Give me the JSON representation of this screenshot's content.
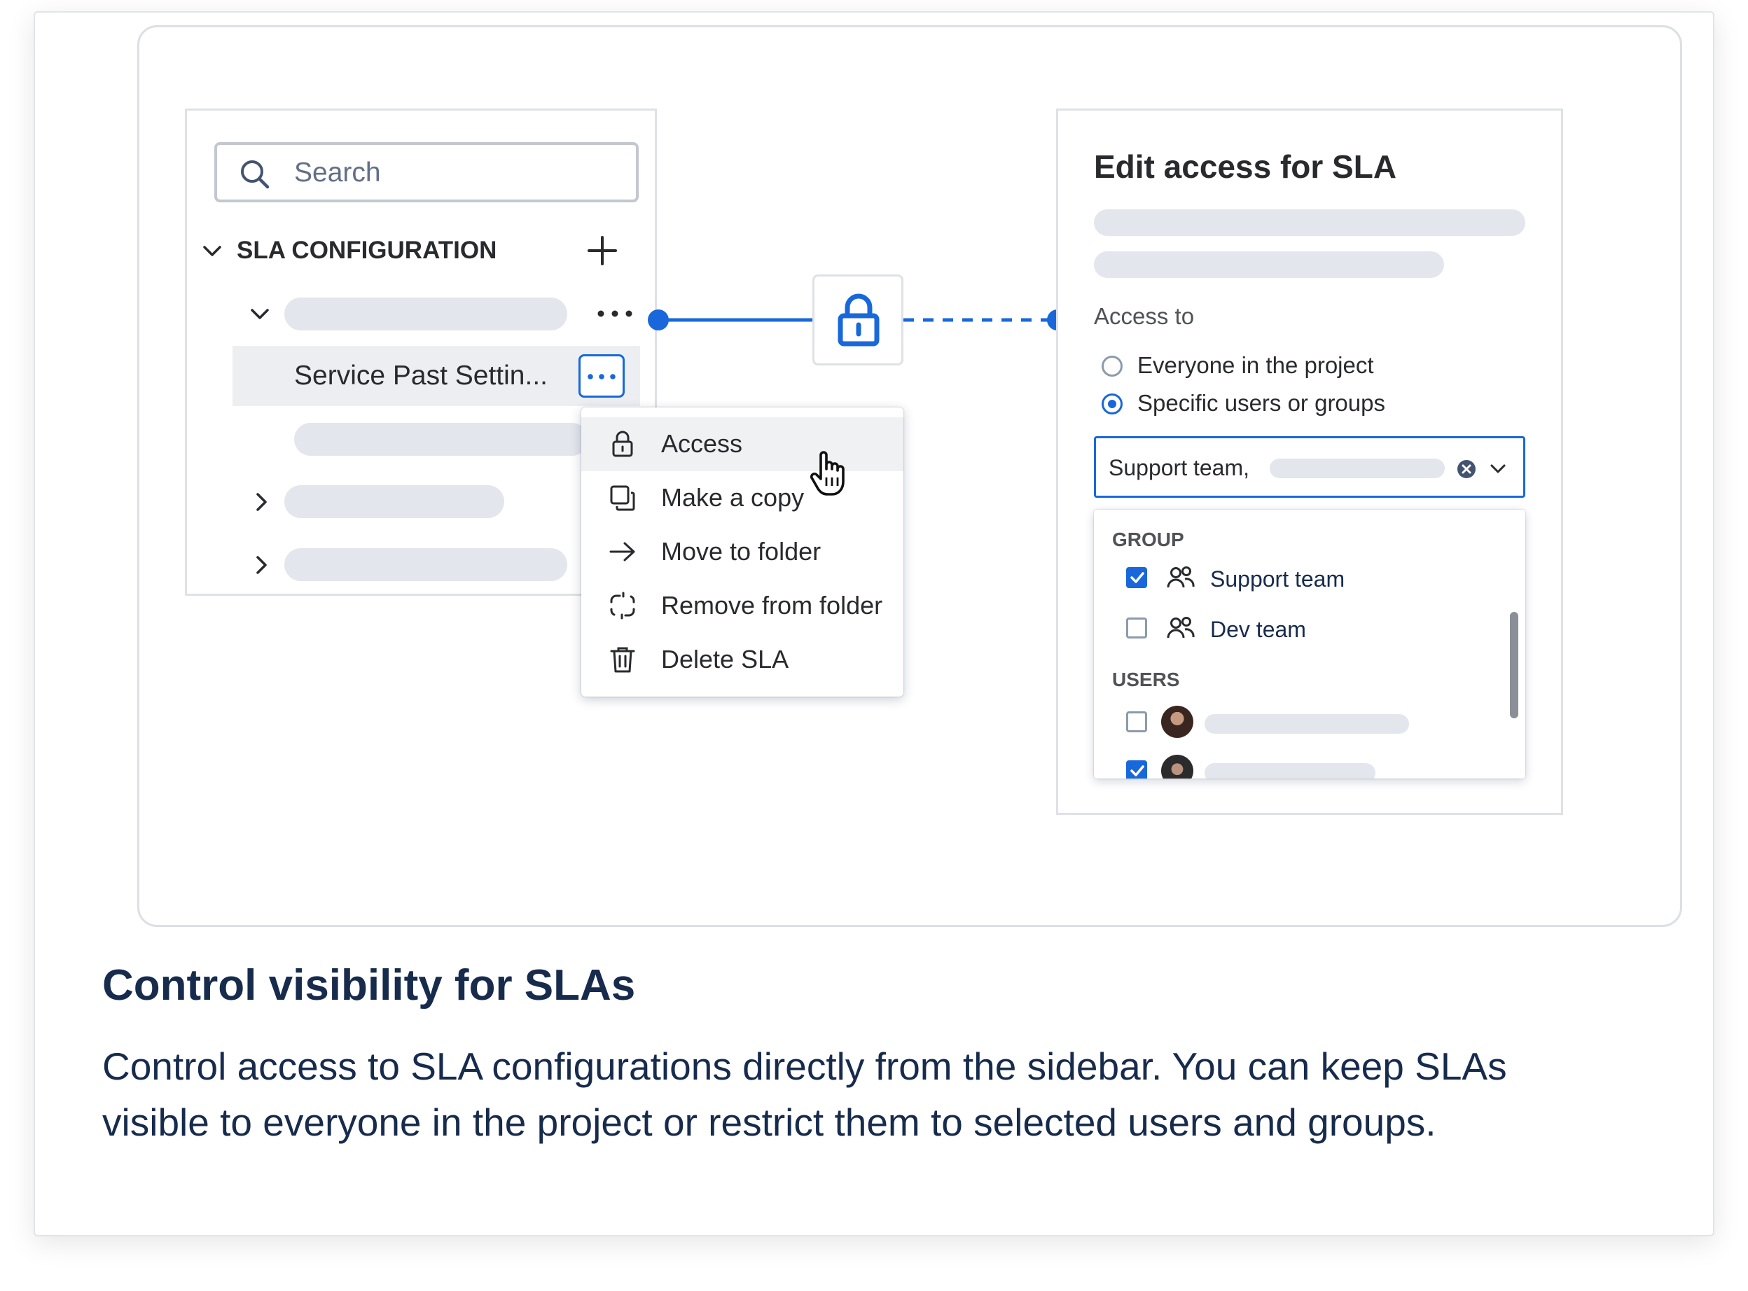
{
  "sidebar": {
    "search": {
      "placeholder": "Search",
      "icon": "search-icon"
    },
    "section_title": "SLA CONFIGURATION",
    "selected_item": "Service Past Settin...",
    "context_menu": {
      "items": [
        {
          "label": "Access",
          "icon": "lock-icon"
        },
        {
          "label": "Make a copy",
          "icon": "copy-icon"
        },
        {
          "label": "Move to folder",
          "icon": "arrow-right-icon"
        },
        {
          "label": "Remove from folder",
          "icon": "unlink-icon"
        },
        {
          "label": "Delete SLA",
          "icon": "trash-icon"
        }
      ]
    }
  },
  "connector": {
    "icon": "lock-icon",
    "color": "#1868db"
  },
  "access_panel": {
    "title": "Edit access for SLA",
    "access_label": "Access to",
    "options": [
      {
        "label": "Everyone in the project",
        "selected": false
      },
      {
        "label": "Specific users or groups",
        "selected": true
      }
    ],
    "select": {
      "value": "Support team,"
    },
    "dropdown": {
      "group_header": "GROUP",
      "groups": [
        {
          "label": "Support team",
          "checked": true
        },
        {
          "label": "Dev team",
          "checked": false
        }
      ],
      "users_header": "USERS",
      "users": [
        {
          "checked": false
        },
        {
          "checked": true
        }
      ]
    }
  },
  "caption": {
    "title": "Control visibility for SLAs",
    "body_line1": "Control access to SLA configurations directly from the sidebar. You can keep SLAs",
    "body_line2": "visible to everyone in the project or restrict them to selected users and groups."
  },
  "colors": {
    "accent": "#1868db",
    "text": "#172b4d",
    "skeleton": "#e3e6ec"
  }
}
